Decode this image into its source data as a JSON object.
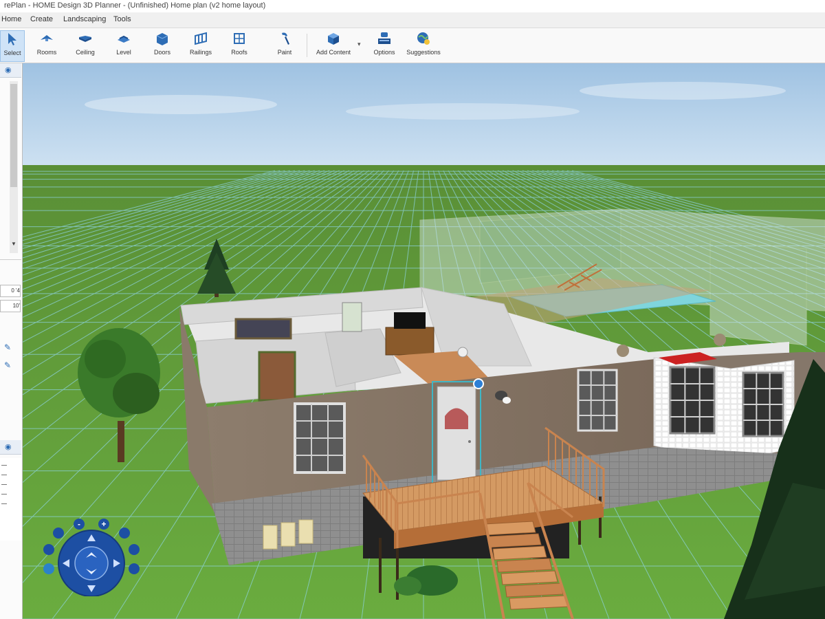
{
  "window": {
    "title": "rePlan - HOME Design 3D Planner - (Unfinished) Home plan (v2 home layout)"
  },
  "menu": {
    "items": [
      "Home",
      "Create",
      "Landscaping",
      "Tools"
    ]
  },
  "toolbar": {
    "buttons": [
      {
        "label": "Select",
        "icon": "select-icon"
      },
      {
        "label": "Rooms",
        "icon": "rooms-icon"
      },
      {
        "label": "Ceiling",
        "icon": "ceiling-icon"
      },
      {
        "label": "Level",
        "icon": "level-icon"
      },
      {
        "label": "Doors",
        "icon": "door-icon"
      },
      {
        "label": "Railings",
        "icon": "railing-icon"
      },
      {
        "label": "Roofs",
        "icon": "roof-icon"
      },
      {
        "label": "Paint",
        "icon": "paint-icon"
      },
      {
        "label": "Add Content",
        "icon": "add-content-icon"
      },
      {
        "label": "Options",
        "icon": "options-icon"
      },
      {
        "label": "Suggestions",
        "icon": "suggestions-icon"
      }
    ]
  },
  "left_panel": {
    "field_1": "0 '4",
    "field_2": "10'"
  },
  "navigation": {
    "zoom_out": "-",
    "zoom_in": "+"
  },
  "colors": {
    "sky_top": "#9fc2e2",
    "grass": "#5f9d3a",
    "grid": "#8fd4e6",
    "wall_brick": "#8c7c6c",
    "deck": "#cc8a55",
    "pool": "#7fd5dc",
    "selection": "#2d7fd6",
    "nav_blue": "#1d4fa3"
  }
}
